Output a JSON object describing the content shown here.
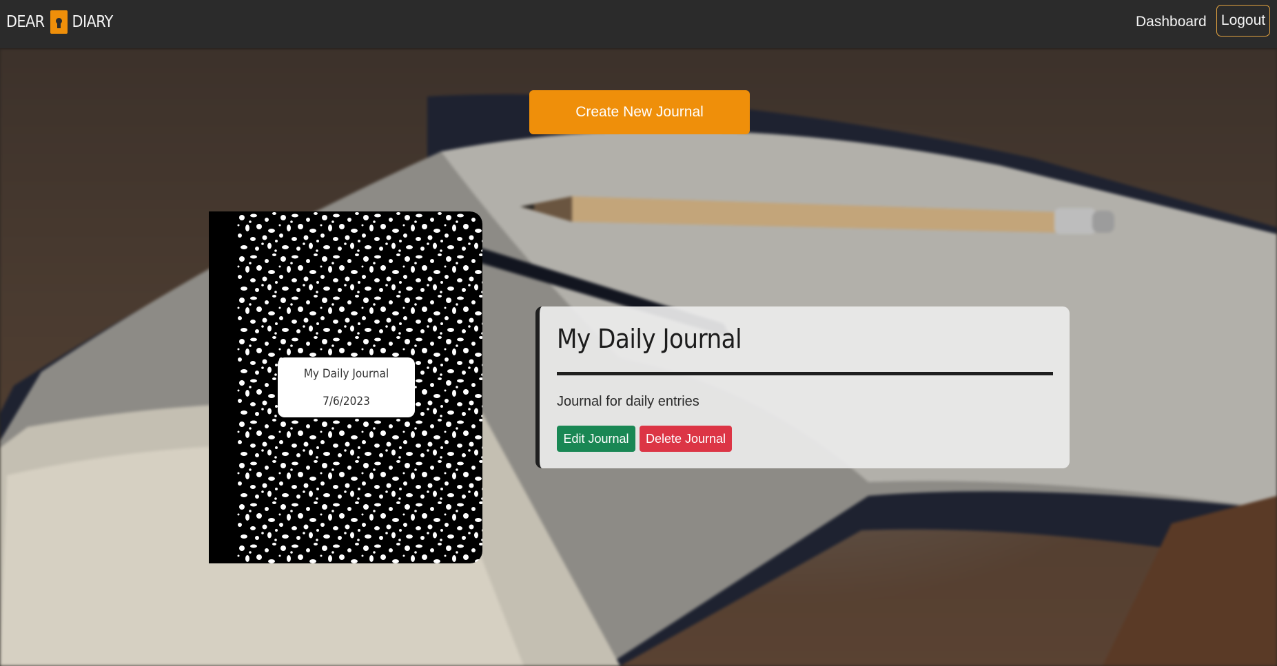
{
  "brand": {
    "left_text": "DEAR",
    "right_text": "DIARY",
    "icon": "keyhole-lock-icon",
    "accent_color": "#ef8f0a"
  },
  "nav": {
    "dashboard_label": "Dashboard",
    "logout_label": "Logout"
  },
  "actions": {
    "create_label": "Create New Journal"
  },
  "journal": {
    "cover_title": "My Daily Journal",
    "cover_date": "7/6/2023",
    "title": "My Daily Journal",
    "description": "Journal for daily entries",
    "edit_label": "Edit Journal",
    "delete_label": "Delete Journal"
  },
  "colors": {
    "navbar": "#2b2b2b",
    "primary_button": "#ef8f0a",
    "edit_button": "#198754",
    "delete_button": "#dc3545"
  }
}
